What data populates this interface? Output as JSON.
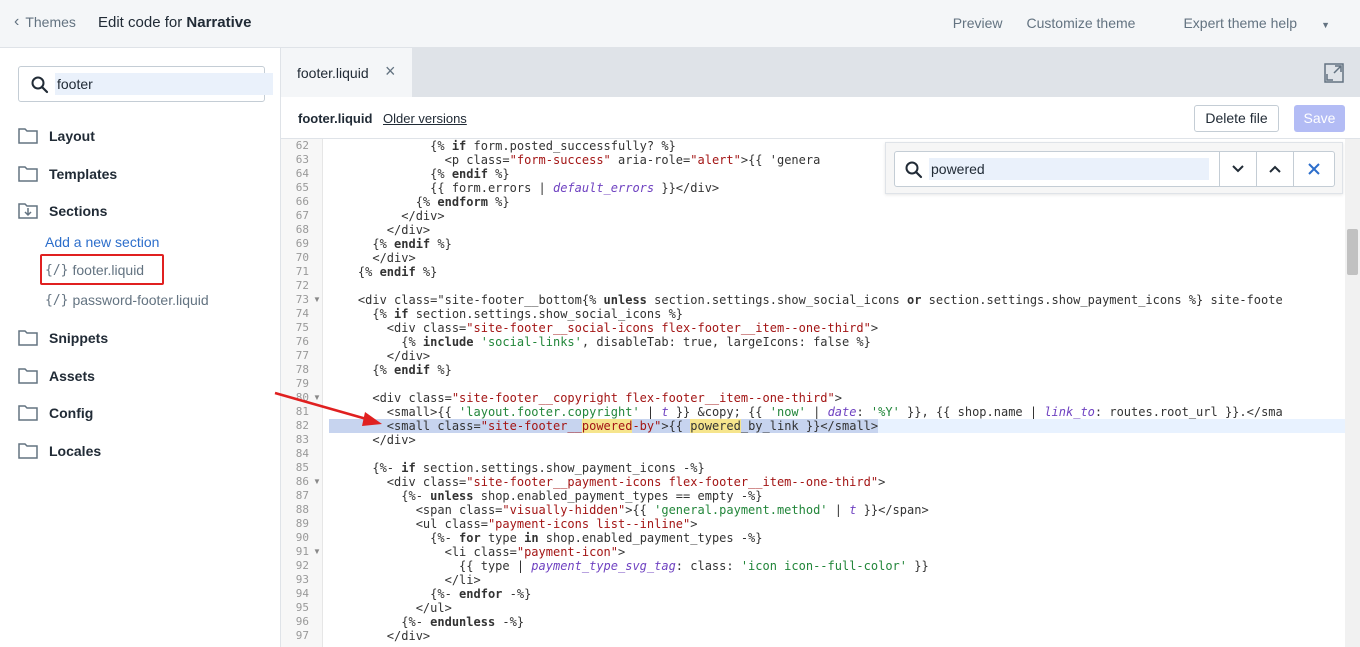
{
  "topbar": {
    "back_label": "Themes",
    "title_prefix": "Edit code for ",
    "theme_name": "Narrative",
    "actions": [
      "Preview",
      "Customize theme",
      "Expert theme help"
    ]
  },
  "sidebar": {
    "search_value": "footer",
    "folders": [
      "Layout",
      "Templates",
      "Sections",
      "Snippets",
      "Assets",
      "Config",
      "Locales"
    ],
    "add_section_label": "Add a new section",
    "files": [
      "footer.liquid",
      "password-footer.liquid"
    ],
    "file_icon": "{/}"
  },
  "editor": {
    "tab_name": "footer.liquid",
    "file_name": "footer.liquid",
    "older_versions": "Older versions",
    "delete_label": "Delete file",
    "save_label": "Save",
    "find_value": "powered",
    "line_numbers": [
      62,
      63,
      64,
      65,
      66,
      67,
      68,
      69,
      70,
      71,
      72,
      73,
      74,
      75,
      76,
      77,
      78,
      79,
      80,
      81,
      82,
      83,
      84,
      85,
      86,
      87,
      88,
      89,
      90,
      91,
      92,
      93,
      94,
      95,
      96,
      97
    ],
    "lines": [
      "              {% if form.posted_successfully? %}",
      "                <p class=\"form-success\" aria-role=\"alert\">{{ 'genera",
      "              {% endif %}",
      "              {{ form.errors | default_errors }}</div>",
      "            {% endform %}",
      "          </div>",
      "        </div>",
      "      {% endif %}",
      "      </div>",
      "    {% endif %}",
      "",
      "    <div class=\"site-footer__bottom{% unless section.settings.show_social_icons or section.settings.show_payment_icons %} site-foote",
      "      {% if section.settings.show_social_icons %}",
      "        <div class=\"site-footer__social-icons flex-footer__item--one-third\">",
      "          {% include 'social-links', disableTab: true, largeIcons: false %}",
      "        </div>",
      "      {% endif %}",
      "",
      "      <div class=\"site-footer__copyright flex-footer__item--one-third\">",
      "        <small>{{ 'layout.footer.copyright' | t }} &copy; {{ 'now' | date: '%Y' }}, {{ shop.name | link_to: routes.root_url }}.</sma",
      "        <small class=\"site-footer__powered-by\">{{ powered_by_link }}</small>",
      "      </div>",
      "",
      "      {%- if section.settings.show_payment_icons -%}",
      "        <div class=\"site-footer__payment-icons flex-footer__item--one-third\">",
      "          {%- unless shop.enabled_payment_types == empty -%}",
      "            <span class=\"visually-hidden\">{{ 'general.payment.method' | t }}</span>",
      "            <ul class=\"payment-icons list--inline\">",
      "              {%- for type in shop.enabled_payment_types -%}",
      "                <li class=\"payment-icon\">",
      "                  {{ type | payment_type_svg_tag: class: 'icon icon--full-color' }}",
      "                </li>",
      "              {%- endfor -%}",
      "            </ul>",
      "          {%- endunless -%}",
      "        </div>"
    ]
  }
}
